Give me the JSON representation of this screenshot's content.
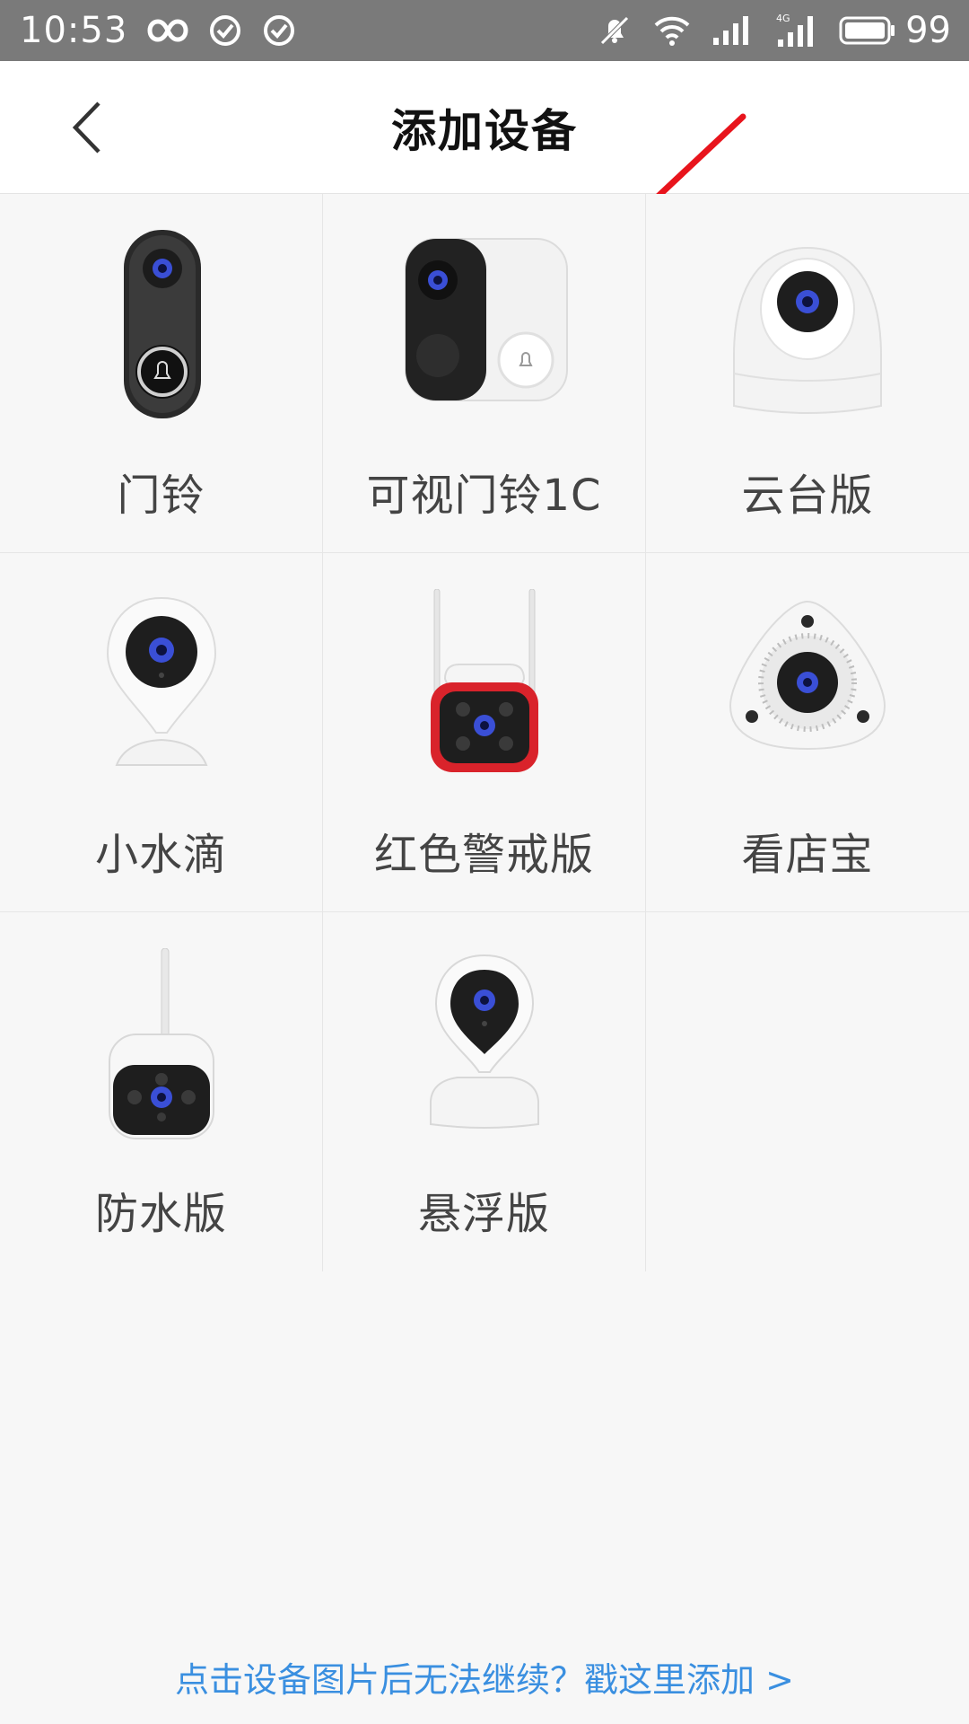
{
  "status_bar": {
    "time": "10:53",
    "battery": "99",
    "icons": [
      "infinity-icon",
      "check-circle-icon",
      "check-circle-icon",
      "mute-icon",
      "wifi-icon",
      "signal-icon",
      "signal-4g-icon",
      "battery-icon"
    ]
  },
  "header": {
    "title": "添加设备",
    "back_icon": "chevron-left-icon"
  },
  "devices": [
    {
      "label": "门铃",
      "icon": "doorbell-icon"
    },
    {
      "label": "可视门铃1C",
      "icon": "video-doorbell-icon"
    },
    {
      "label": "云台版",
      "icon": "ptz-camera-icon"
    },
    {
      "label": "小水滴",
      "icon": "drop-camera-icon"
    },
    {
      "label": "红色警戒版",
      "icon": "red-alert-camera-icon"
    },
    {
      "label": "看店宝",
      "icon": "store-camera-icon"
    },
    {
      "label": "防水版",
      "icon": "waterproof-camera-icon"
    },
    {
      "label": "悬浮版",
      "icon": "floating-camera-icon"
    }
  ],
  "footer": {
    "link_text": "点击设备图片后无法继续？戳这里添加 >"
  },
  "colors": {
    "status_bar": "#7a7a7a",
    "link": "#3a8fe0",
    "arrow": "#e8141c",
    "background": "#f7f7f7"
  }
}
